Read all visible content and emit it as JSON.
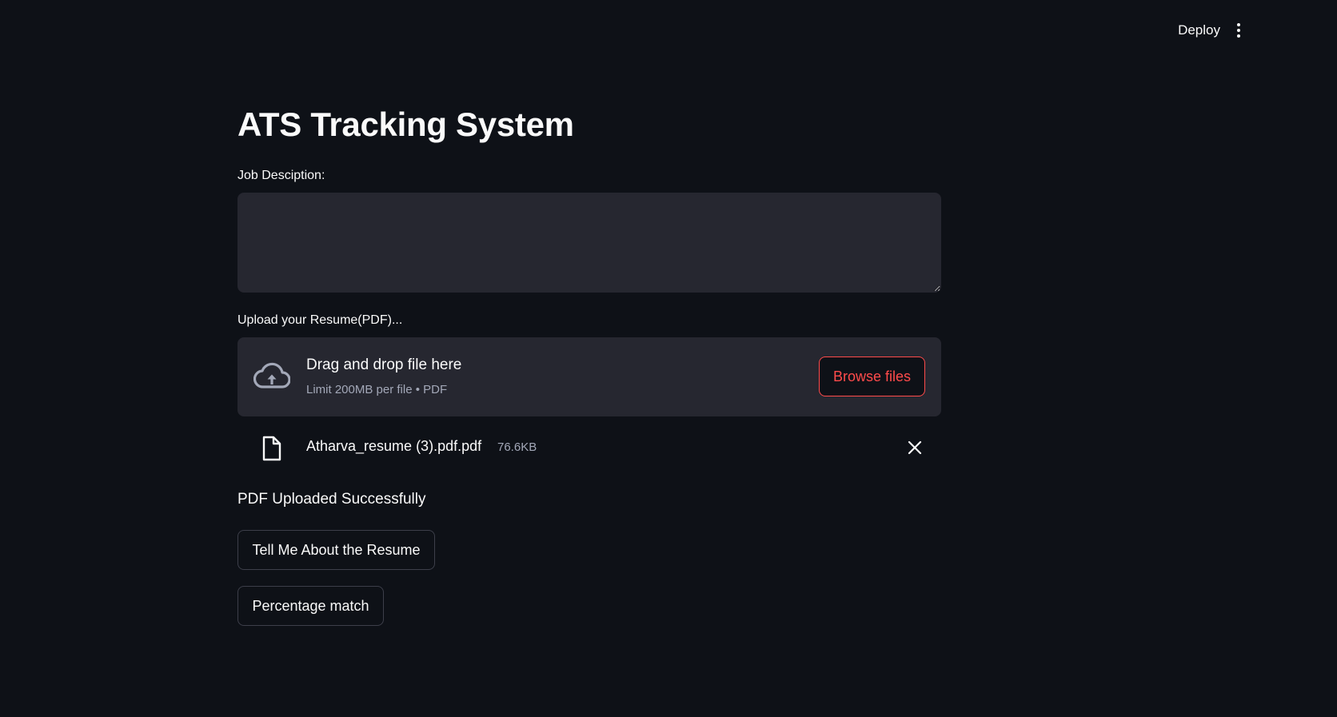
{
  "header": {
    "deploy_label": "Deploy"
  },
  "main": {
    "title": "ATS Tracking System",
    "job_description_label": "Job Desciption:",
    "job_description_value": "",
    "upload_label": "Upload your Resume(PDF)...",
    "dropzone": {
      "title": "Drag and drop file here",
      "limit": "Limit 200MB per file • PDF",
      "browse_label": "Browse files"
    },
    "uploaded_file": {
      "name": "Atharva_resume (3).pdf.pdf",
      "size": "76.6KB"
    },
    "status": "PDF Uploaded Successfully",
    "buttons": {
      "tell_me_label": "Tell Me About the Resume",
      "percentage_label": "Percentage match"
    }
  },
  "colors": {
    "background": "#0e1117",
    "input_bg": "#262730",
    "accent": "#ff4b4b",
    "muted_text": "#a3a8b8"
  }
}
